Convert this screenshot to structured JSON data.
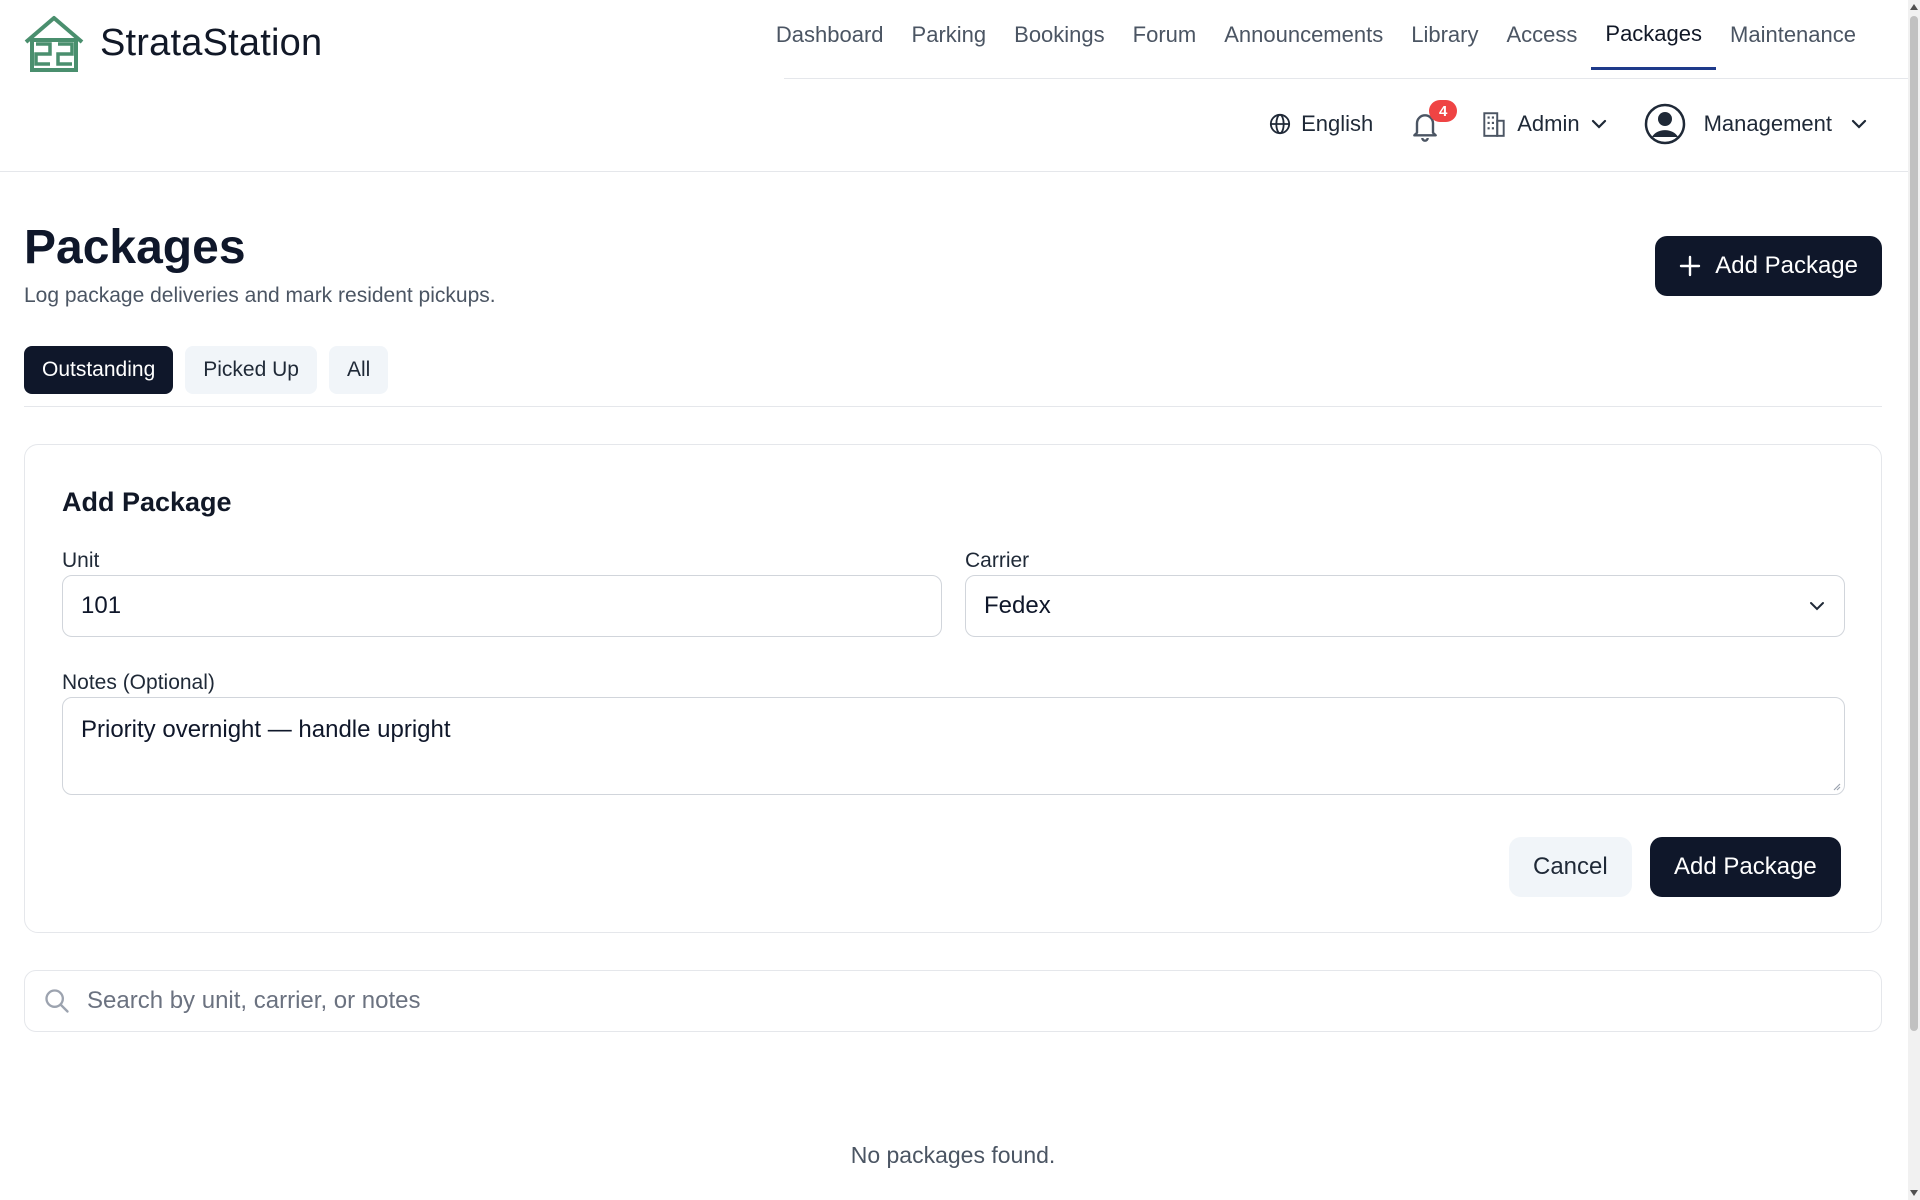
{
  "brand": {
    "name": "StrataStation",
    "logo_icon": "house-logo-icon",
    "color": "#4a8f6e"
  },
  "nav": {
    "items": [
      {
        "label": "Dashboard"
      },
      {
        "label": "Parking"
      },
      {
        "label": "Bookings"
      },
      {
        "label": "Forum"
      },
      {
        "label": "Announcements"
      },
      {
        "label": "Library"
      },
      {
        "label": "Access"
      },
      {
        "label": "Packages",
        "active": true
      },
      {
        "label": "Maintenance"
      }
    ]
  },
  "toolbar": {
    "language": "English",
    "notifications_count": "4",
    "building": "Admin",
    "user": "Management"
  },
  "page": {
    "title": "Packages",
    "subtitle": "Log package deliveries and mark resident pickups.",
    "add_button": "Add Package"
  },
  "tabs": [
    {
      "label": "Outstanding",
      "active": true
    },
    {
      "label": "Picked Up"
    },
    {
      "label": "All"
    }
  ],
  "form": {
    "title": "Add Package",
    "unit_label": "Unit",
    "unit_value": "101",
    "carrier_label": "Carrier",
    "carrier_value": "Fedex",
    "notes_label": "Notes (Optional)",
    "notes_value": "Priority overnight — handle upright",
    "cancel_label": "Cancel",
    "submit_label": "Add Package"
  },
  "search": {
    "placeholder": "Search by unit, carrier, or notes"
  },
  "empty_message": "No packages found.",
  "colors": {
    "primary": "#0f172a",
    "accent_underline": "#1e3a8a",
    "badge": "#ef4444"
  }
}
